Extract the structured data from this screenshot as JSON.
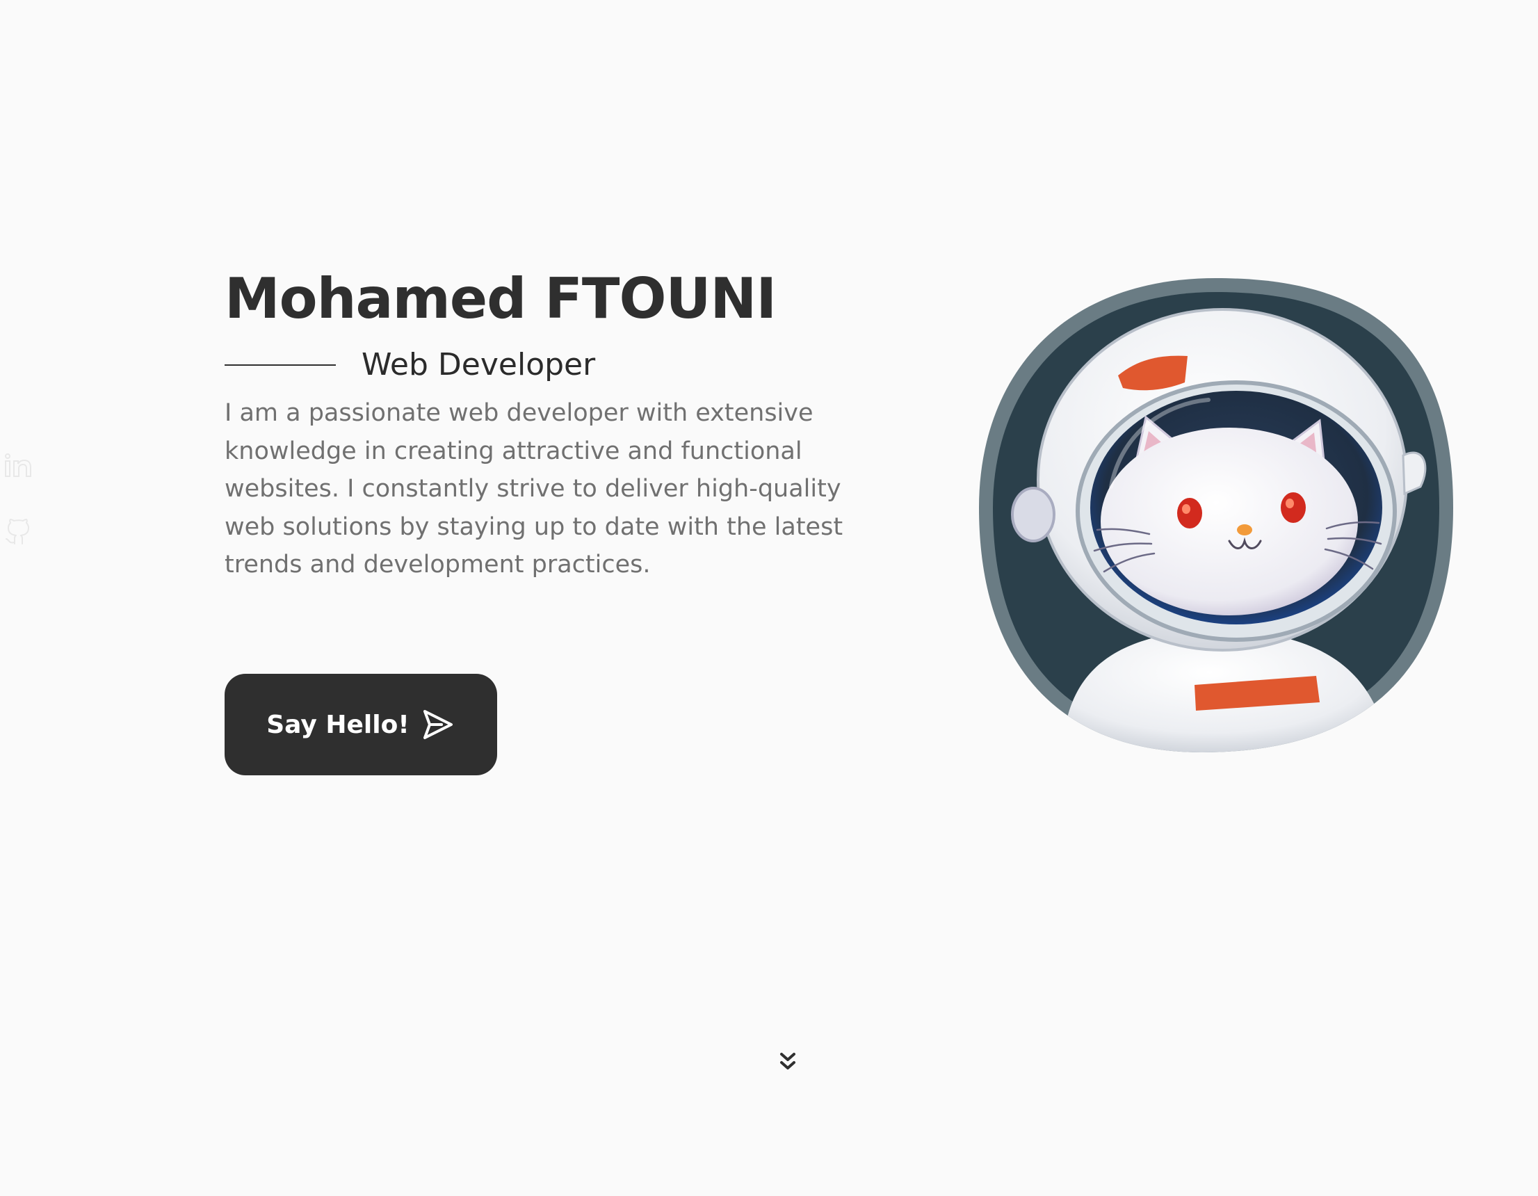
{
  "hero": {
    "name": "Mohamed FTOUNI",
    "subtitle": "Web Developer",
    "bio": "I am a passionate web developer with extensive knowledge in creating attractive and functional websites. I constantly strive to deliver high-quality web solutions by staying up to date with the latest trends and development practices.",
    "cta_label": "Say Hello!"
  },
  "social": {
    "items": [
      {
        "icon": "linkedin-icon"
      },
      {
        "icon": "github-icon"
      }
    ]
  },
  "avatar": {
    "subject": "cat-astronaut",
    "colors": {
      "frame": "#6a7c84",
      "inner_background": "#2b404b",
      "helmet": "#f1f1f3",
      "accent": "#e0582f"
    }
  },
  "scroll": {
    "icon": "chevrons-down-icon"
  },
  "theme": {
    "background": "#fafafa",
    "text_dark": "#2f2f2f",
    "text_muted": "#707070",
    "button_background": "#2f2f2f",
    "button_text": "#ffffff"
  }
}
